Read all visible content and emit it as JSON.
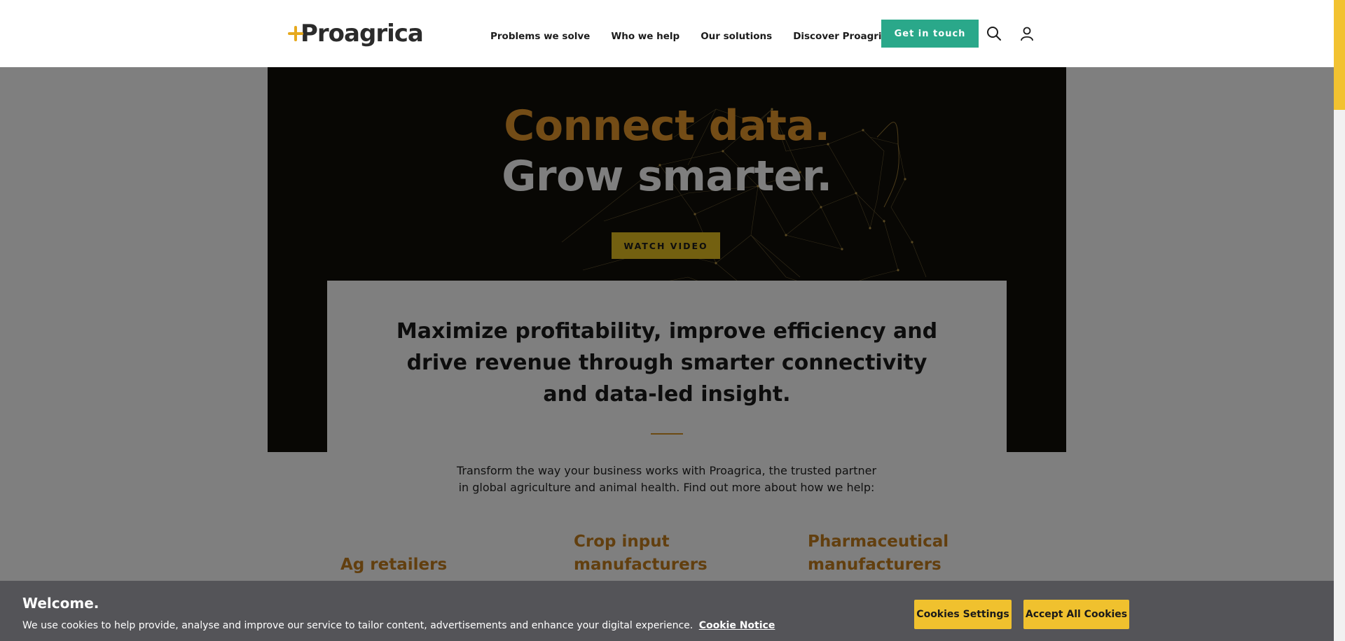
{
  "header": {
    "logo_text": "Proagrica",
    "nav": [
      {
        "label": "Problems we solve"
      },
      {
        "label": "Who we help"
      },
      {
        "label": "Our solutions"
      },
      {
        "label": "Discover Proagrica"
      }
    ],
    "cta_label": "Get in touch",
    "icons": [
      "search-icon",
      "user-icon"
    ]
  },
  "hero": {
    "line1": "Connect data.",
    "line2": "Grow smarter.",
    "watch_label": "WATCH VIDEO"
  },
  "card": {
    "heading": "Maximize profitability, improve efficiency and drive revenue through smarter connectivity and data-led insight."
  },
  "intro": {
    "line1": "Transform the way your business works with Proagrica, the trusted partner",
    "line2": "in global agriculture and animal health. Find out more about how we help:"
  },
  "categories": [
    {
      "label": "Ag retailers"
    },
    {
      "label": "Crop input manufacturers"
    },
    {
      "label": "Pharmaceutical manufacturers"
    }
  ],
  "cookie": {
    "title": "Welcome.",
    "text": "We use cookies to help provide, analyse and improve our service to tailor content, advertisements and enhance your digital experience.",
    "link": "Cookie Notice",
    "settings_label": "Cookies Settings",
    "accept_label": "Accept All Cookies"
  },
  "colors": {
    "brand_green": "#2aa88a",
    "accent_orange": "#e7982d",
    "accent_yellow": "#f0c12e",
    "hero_bg": "#110f09",
    "cookie_bg": "#545458"
  }
}
